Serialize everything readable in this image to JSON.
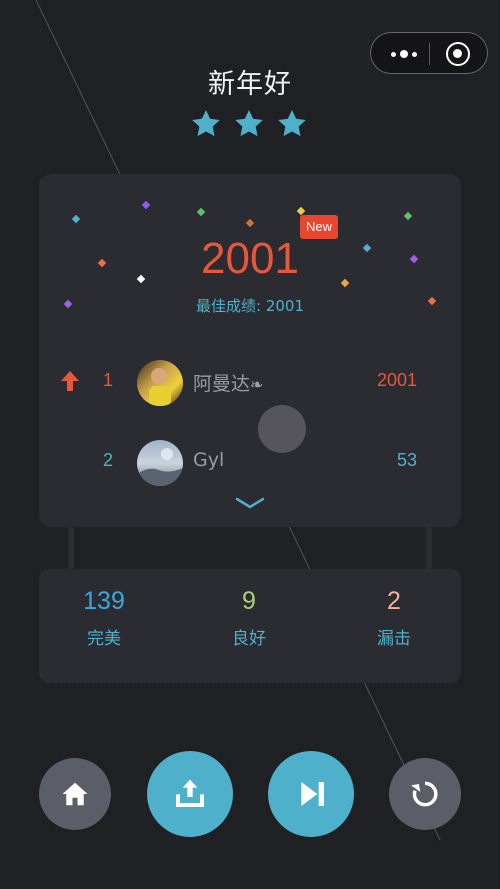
{
  "header": {
    "title": "新年好",
    "stars_earned": 3,
    "stars_total": 3
  },
  "result": {
    "score": "2001",
    "new_badge": "New",
    "best_label": "最佳成绩: 2001"
  },
  "leaderboard": [
    {
      "rank": "1",
      "name": "阿曼达",
      "points": "2001",
      "trend": "up",
      "rank_color": "#e8563c"
    },
    {
      "rank": "2",
      "name": "Gyl",
      "points": "53",
      "trend": "",
      "rank_color": "#4fb0cb"
    }
  ],
  "stats": [
    {
      "value": "139",
      "label": "完美",
      "color": "#3aa8dd"
    },
    {
      "value": "9",
      "label": "良好",
      "color": "#a9d17a"
    },
    {
      "value": "2",
      "label": "漏击",
      "color": "#f2b49a"
    }
  ],
  "actions": {
    "home": "home-icon",
    "share": "share-icon",
    "next": "next-track-icon",
    "retry": "retry-icon"
  },
  "colors": {
    "background": "#1f2024",
    "card": "#2b2c31",
    "accent_red": "#e8563c",
    "accent_teal": "#4fb0cb",
    "star": "#4fb0cb"
  }
}
